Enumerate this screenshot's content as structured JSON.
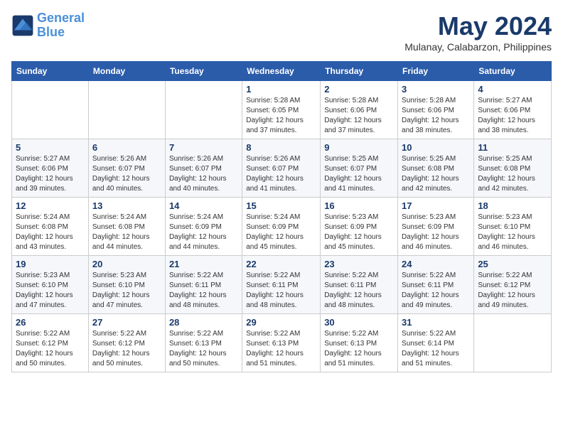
{
  "header": {
    "logo_line1": "General",
    "logo_line2": "Blue",
    "month": "May 2024",
    "location": "Mulanay, Calabarzon, Philippines"
  },
  "days_of_week": [
    "Sunday",
    "Monday",
    "Tuesday",
    "Wednesday",
    "Thursday",
    "Friday",
    "Saturday"
  ],
  "weeks": [
    [
      {
        "day": "",
        "info": ""
      },
      {
        "day": "",
        "info": ""
      },
      {
        "day": "",
        "info": ""
      },
      {
        "day": "1",
        "info": "Sunrise: 5:28 AM\nSunset: 6:05 PM\nDaylight: 12 hours\nand 37 minutes."
      },
      {
        "day": "2",
        "info": "Sunrise: 5:28 AM\nSunset: 6:06 PM\nDaylight: 12 hours\nand 37 minutes."
      },
      {
        "day": "3",
        "info": "Sunrise: 5:28 AM\nSunset: 6:06 PM\nDaylight: 12 hours\nand 38 minutes."
      },
      {
        "day": "4",
        "info": "Sunrise: 5:27 AM\nSunset: 6:06 PM\nDaylight: 12 hours\nand 38 minutes."
      }
    ],
    [
      {
        "day": "5",
        "info": "Sunrise: 5:27 AM\nSunset: 6:06 PM\nDaylight: 12 hours\nand 39 minutes."
      },
      {
        "day": "6",
        "info": "Sunrise: 5:26 AM\nSunset: 6:07 PM\nDaylight: 12 hours\nand 40 minutes."
      },
      {
        "day": "7",
        "info": "Sunrise: 5:26 AM\nSunset: 6:07 PM\nDaylight: 12 hours\nand 40 minutes."
      },
      {
        "day": "8",
        "info": "Sunrise: 5:26 AM\nSunset: 6:07 PM\nDaylight: 12 hours\nand 41 minutes."
      },
      {
        "day": "9",
        "info": "Sunrise: 5:25 AM\nSunset: 6:07 PM\nDaylight: 12 hours\nand 41 minutes."
      },
      {
        "day": "10",
        "info": "Sunrise: 5:25 AM\nSunset: 6:08 PM\nDaylight: 12 hours\nand 42 minutes."
      },
      {
        "day": "11",
        "info": "Sunrise: 5:25 AM\nSunset: 6:08 PM\nDaylight: 12 hours\nand 42 minutes."
      }
    ],
    [
      {
        "day": "12",
        "info": "Sunrise: 5:24 AM\nSunset: 6:08 PM\nDaylight: 12 hours\nand 43 minutes."
      },
      {
        "day": "13",
        "info": "Sunrise: 5:24 AM\nSunset: 6:08 PM\nDaylight: 12 hours\nand 44 minutes."
      },
      {
        "day": "14",
        "info": "Sunrise: 5:24 AM\nSunset: 6:09 PM\nDaylight: 12 hours\nand 44 minutes."
      },
      {
        "day": "15",
        "info": "Sunrise: 5:24 AM\nSunset: 6:09 PM\nDaylight: 12 hours\nand 45 minutes."
      },
      {
        "day": "16",
        "info": "Sunrise: 5:23 AM\nSunset: 6:09 PM\nDaylight: 12 hours\nand 45 minutes."
      },
      {
        "day": "17",
        "info": "Sunrise: 5:23 AM\nSunset: 6:09 PM\nDaylight: 12 hours\nand 46 minutes."
      },
      {
        "day": "18",
        "info": "Sunrise: 5:23 AM\nSunset: 6:10 PM\nDaylight: 12 hours\nand 46 minutes."
      }
    ],
    [
      {
        "day": "19",
        "info": "Sunrise: 5:23 AM\nSunset: 6:10 PM\nDaylight: 12 hours\nand 47 minutes."
      },
      {
        "day": "20",
        "info": "Sunrise: 5:23 AM\nSunset: 6:10 PM\nDaylight: 12 hours\nand 47 minutes."
      },
      {
        "day": "21",
        "info": "Sunrise: 5:22 AM\nSunset: 6:11 PM\nDaylight: 12 hours\nand 48 minutes."
      },
      {
        "day": "22",
        "info": "Sunrise: 5:22 AM\nSunset: 6:11 PM\nDaylight: 12 hours\nand 48 minutes."
      },
      {
        "day": "23",
        "info": "Sunrise: 5:22 AM\nSunset: 6:11 PM\nDaylight: 12 hours\nand 48 minutes."
      },
      {
        "day": "24",
        "info": "Sunrise: 5:22 AM\nSunset: 6:11 PM\nDaylight: 12 hours\nand 49 minutes."
      },
      {
        "day": "25",
        "info": "Sunrise: 5:22 AM\nSunset: 6:12 PM\nDaylight: 12 hours\nand 49 minutes."
      }
    ],
    [
      {
        "day": "26",
        "info": "Sunrise: 5:22 AM\nSunset: 6:12 PM\nDaylight: 12 hours\nand 50 minutes."
      },
      {
        "day": "27",
        "info": "Sunrise: 5:22 AM\nSunset: 6:12 PM\nDaylight: 12 hours\nand 50 minutes."
      },
      {
        "day": "28",
        "info": "Sunrise: 5:22 AM\nSunset: 6:13 PM\nDaylight: 12 hours\nand 50 minutes."
      },
      {
        "day": "29",
        "info": "Sunrise: 5:22 AM\nSunset: 6:13 PM\nDaylight: 12 hours\nand 51 minutes."
      },
      {
        "day": "30",
        "info": "Sunrise: 5:22 AM\nSunset: 6:13 PM\nDaylight: 12 hours\nand 51 minutes."
      },
      {
        "day": "31",
        "info": "Sunrise: 5:22 AM\nSunset: 6:14 PM\nDaylight: 12 hours\nand 51 minutes."
      },
      {
        "day": "",
        "info": ""
      }
    ]
  ]
}
